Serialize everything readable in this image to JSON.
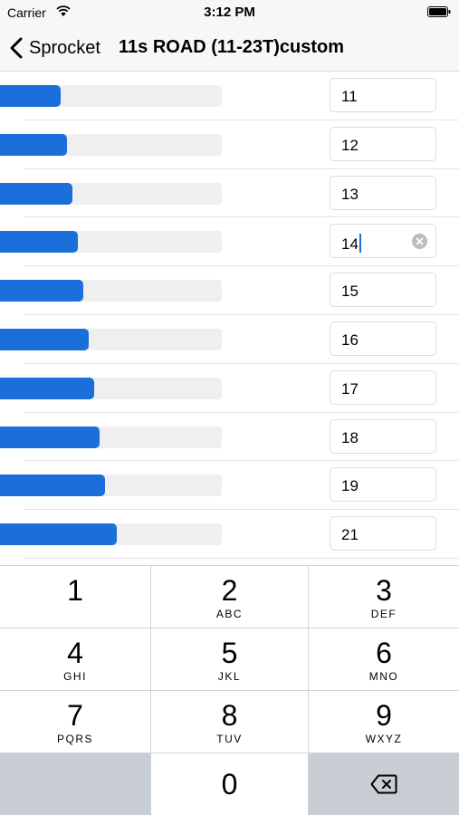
{
  "status_bar": {
    "carrier": "Carrier",
    "time": "3:12 PM"
  },
  "nav": {
    "back_label": "Sprocket",
    "title": "11s ROAD (11-23T)custom"
  },
  "colors": {
    "accent": "#1a6fdb",
    "track": "#efefef",
    "keypad_bg": "#cfd3d9",
    "key_gray": "#c9cdd4"
  },
  "sprockets": [
    {
      "teeth": "11",
      "fill_fraction": 0.275
    },
    {
      "teeth": "12",
      "fill_fraction": 0.3
    },
    {
      "teeth": "13",
      "fill_fraction": 0.325
    },
    {
      "teeth": "14",
      "fill_fraction": 0.35,
      "editing": true
    },
    {
      "teeth": "15",
      "fill_fraction": 0.375
    },
    {
      "teeth": "16",
      "fill_fraction": 0.4
    },
    {
      "teeth": "17",
      "fill_fraction": 0.425
    },
    {
      "teeth": "18",
      "fill_fraction": 0.45
    },
    {
      "teeth": "19",
      "fill_fraction": 0.475
    },
    {
      "teeth": "21",
      "fill_fraction": 0.525
    }
  ],
  "keypad": {
    "keys": [
      {
        "digit": "1",
        "letters": ""
      },
      {
        "digit": "2",
        "letters": "ABC"
      },
      {
        "digit": "3",
        "letters": "DEF"
      },
      {
        "digit": "4",
        "letters": "GHI"
      },
      {
        "digit": "5",
        "letters": "JKL"
      },
      {
        "digit": "6",
        "letters": "MNO"
      },
      {
        "digit": "7",
        "letters": "PQRS"
      },
      {
        "digit": "8",
        "letters": "TUV"
      },
      {
        "digit": "9",
        "letters": "WXYZ"
      },
      {
        "digit": "0",
        "letters": ""
      }
    ],
    "delete_icon": "delete-backspace-icon"
  }
}
